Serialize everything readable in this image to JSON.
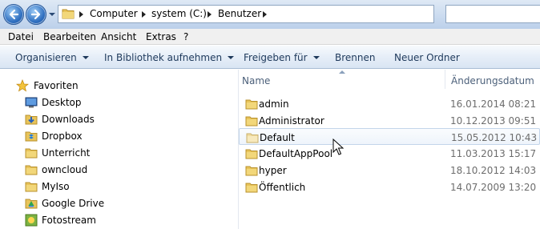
{
  "address": {
    "breadcrumbs": [
      "Computer",
      "system (C:)",
      "Benutzer"
    ]
  },
  "menu": {
    "items": [
      "Datei",
      "Bearbeiten",
      "Ansicht",
      "Extras",
      "?"
    ]
  },
  "toolbar": {
    "organize": "Organisieren",
    "library": "In Bibliothek aufnehmen",
    "share": "Freigeben für",
    "burn": "Brennen",
    "new_folder": "Neuer Ordner"
  },
  "nav": {
    "favorites": "Favoriten",
    "items": [
      {
        "label": "Desktop",
        "icon": "desktop-icon"
      },
      {
        "label": "Downloads",
        "icon": "downloads-folder-icon"
      },
      {
        "label": "Dropbox",
        "icon": "dropbox-folder-icon"
      },
      {
        "label": "Unterricht",
        "icon": "folder-icon"
      },
      {
        "label": "owncloud",
        "icon": "folder-icon"
      },
      {
        "label": "MyIso",
        "icon": "folder-icon"
      },
      {
        "label": "Google Drive",
        "icon": "google-drive-folder-icon"
      },
      {
        "label": "Fotostream",
        "icon": "photostream-icon"
      }
    ]
  },
  "files": {
    "columns": {
      "name": "Name",
      "modified": "Änderungsdatum"
    },
    "rows": [
      {
        "name": "admin",
        "modified": "16.01.2014 08:21"
      },
      {
        "name": "Administrator",
        "modified": "10.12.2013 09:51"
      },
      {
        "name": "Default",
        "modified": "15.05.2012 10:43",
        "selected": true
      },
      {
        "name": "DefaultAppPool",
        "modified": "11.03.2013 15:17"
      },
      {
        "name": "hyper",
        "modified": "18.10.2012 14:03"
      },
      {
        "name": "Öffentlich",
        "modified": "14.07.2009 13:20"
      }
    ]
  },
  "colors": {
    "toolbar_text": "#1e395b",
    "folder": "#e8c45a",
    "date_text": "#6d6d6d",
    "selection_border": "#c3d5ea"
  }
}
